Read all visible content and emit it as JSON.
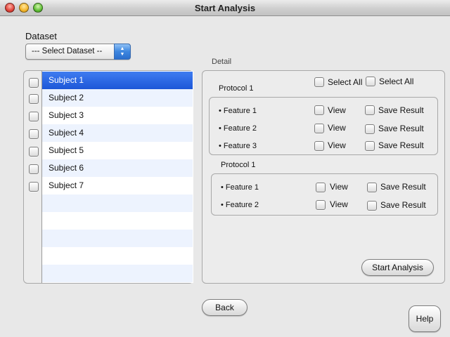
{
  "window": {
    "title": "Start Analysis"
  },
  "dataset": {
    "label": "Dataset",
    "select_value": "--- Select Dataset --"
  },
  "subjects": [
    {
      "label": "Subject 1",
      "selected": true
    },
    {
      "label": "Subject 2",
      "selected": false
    },
    {
      "label": "Subject 3",
      "selected": false
    },
    {
      "label": "Subject 4",
      "selected": false
    },
    {
      "label": "Subject 5",
      "selected": false
    },
    {
      "label": "Subject 6",
      "selected": false
    },
    {
      "label": "Subject 7",
      "selected": false
    }
  ],
  "detail": {
    "label": "Detail",
    "select_all_view": "Select All",
    "select_all_save": "Select All",
    "protocols": [
      {
        "title": "Protocol 1",
        "features": [
          {
            "name": "• Feature 1",
            "view": "View",
            "save": "Save Result"
          },
          {
            "name": "• Feature 2",
            "view": "View",
            "save": "Save Result"
          },
          {
            "name": "• Feature 3",
            "view": "View",
            "save": "Save Result"
          }
        ]
      },
      {
        "title": "Protocol 1",
        "features": [
          {
            "name": "• Feature 1",
            "view": "View",
            "save": "Save Result"
          },
          {
            "name": "• Feature 2",
            "view": "View",
            "save": "Save Result"
          }
        ]
      }
    ],
    "start_button": "Start Analysis"
  },
  "footer": {
    "back_button": "Back",
    "help_button": "Help"
  },
  "colors": {
    "selection": "#2a63e0",
    "stripe": "#edf3fe",
    "background": "#e8e8e8"
  }
}
